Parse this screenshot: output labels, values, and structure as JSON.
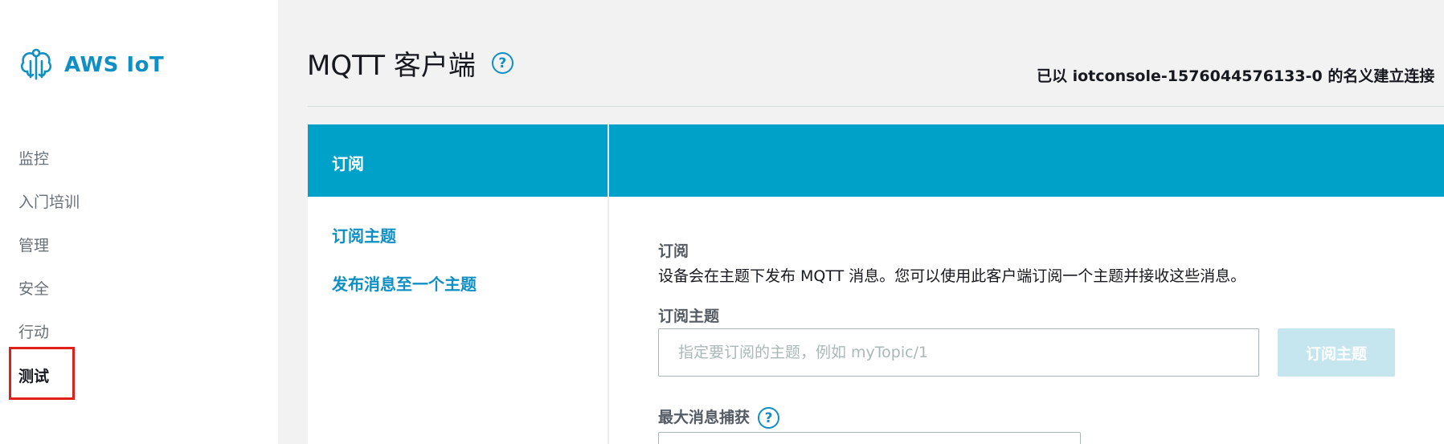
{
  "brand": {
    "name": "AWS IoT"
  },
  "sidebar": {
    "items": [
      {
        "label": "监控"
      },
      {
        "label": "入门培训"
      },
      {
        "label": "管理"
      },
      {
        "label": "安全"
      },
      {
        "label": "行动"
      },
      {
        "label": "测试"
      }
    ]
  },
  "header": {
    "title": "MQTT 客户端",
    "help": "?",
    "connection": "已以 iotconsole-1576044576133-0 的名义建立连接"
  },
  "panel": {
    "head_title": "订阅",
    "side_links": [
      {
        "label": "订阅主题"
      },
      {
        "label": "发布消息至一个主题"
      }
    ],
    "section_title": "订阅",
    "description": "设备会在主题下发布 MQTT 消息。您可以使用此客户端订阅一个主题并接收这些消息。",
    "topic_label": "订阅主题",
    "topic_placeholder": "指定要订阅的主题，例如 myTopic/1",
    "subscribe_button": "订阅主题",
    "max_label": "最大消息捕获",
    "max_help": "?"
  },
  "colors": {
    "accent": "#00a1c9",
    "link": "#0f8fc3",
    "highlight": "#e0201b"
  }
}
